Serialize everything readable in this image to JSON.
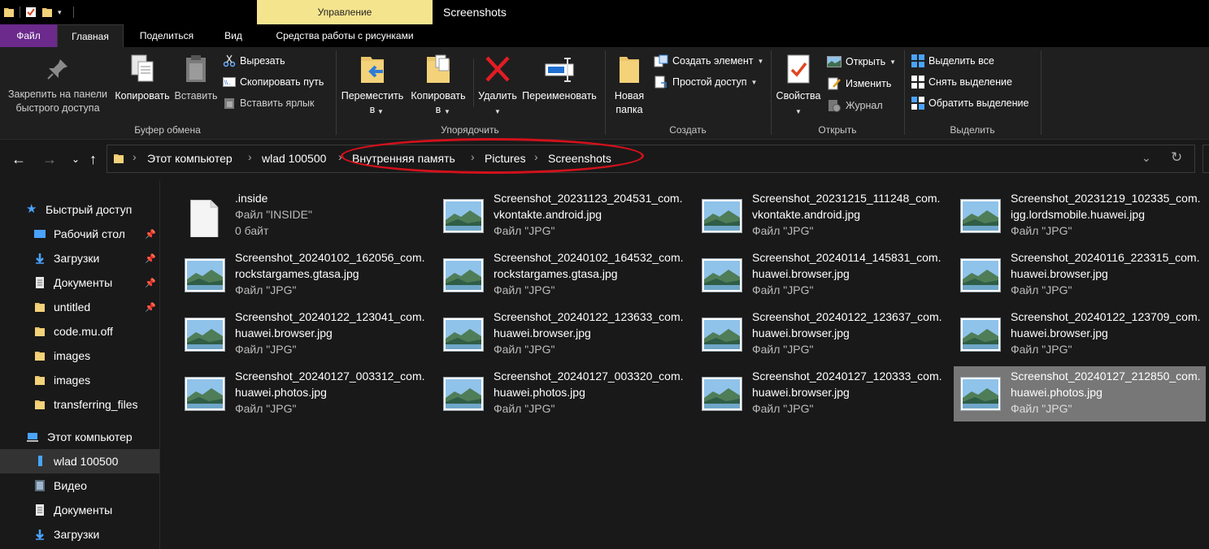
{
  "window": {
    "title": "Screenshots",
    "context_tab_header": "Управление"
  },
  "ribbon_tabs": {
    "file": "Файл",
    "home": "Главная",
    "share": "Поделиться",
    "view": "Вид",
    "picture_tools": "Средства работы с рисунками"
  },
  "ribbon": {
    "clipboard": {
      "label": "Буфер обмена",
      "pin_line1": "Закрепить на панели",
      "pin_line2": "быстрого доступа",
      "copy": "Копировать",
      "paste": "Вставить",
      "cut": "Вырезать",
      "copy_path": "Скопировать путь",
      "paste_shortcut": "Вставить ярлык"
    },
    "organize": {
      "label": "Упорядочить",
      "move_line1": "Переместить",
      "move_line2": "в",
      "copyto_line1": "Копировать",
      "copyto_line2": "в",
      "delete": "Удалить",
      "rename": "Переименовать"
    },
    "new": {
      "label": "Создать",
      "new_folder_line1": "Новая",
      "new_folder_line2": "папка",
      "new_item": "Создать элемент",
      "easy_access": "Простой доступ"
    },
    "open": {
      "label": "Открыть",
      "properties": "Свойства",
      "open": "Открыть",
      "edit": "Изменить",
      "history": "Журнал"
    },
    "select": {
      "label": "Выделить",
      "select_all": "Выделить все",
      "select_none": "Снять выделение",
      "invert": "Обратить выделение"
    }
  },
  "address": {
    "crumbs": [
      "Этот компьютер",
      "wlad 100500",
      "Внутренняя память",
      "Pictures",
      "Screenshots"
    ]
  },
  "nav_pane": {
    "quick_access": "Быстрый доступ",
    "items": [
      "Рабочий стол",
      "Загрузки",
      "Документы",
      "untitled",
      "code.mu.off",
      "images",
      "images",
      "transferring_files"
    ],
    "this_pc": "Этот компьютер",
    "pc_items": [
      "wlad 100500",
      "Видео",
      "Документы",
      "Загрузки"
    ]
  },
  "files": [
    {
      "name1": ".inside",
      "name2": "Файл \"INSIDE\"",
      "type": "0 байт"
    },
    {
      "name1": "Screenshot_20231123_204531_com.",
      "name2": "vkontakte.android.jpg",
      "type": "Файл \"JPG\""
    },
    {
      "name1": "Screenshot_20231215_111248_com.",
      "name2": "vkontakte.android.jpg",
      "type": "Файл \"JPG\""
    },
    {
      "name1": "Screenshot_20231219_102335_com.",
      "name2": "igg.lordsmobile.huawei.jpg",
      "type": "Файл \"JPG\""
    },
    {
      "name1": "Screenshot_20240102_162056_com.",
      "name2": "rockstargames.gtasa.jpg",
      "type": "Файл \"JPG\""
    },
    {
      "name1": "Screenshot_20240102_164532_com.",
      "name2": "rockstargames.gtasa.jpg",
      "type": "Файл \"JPG\""
    },
    {
      "name1": "Screenshot_20240114_145831_com.",
      "name2": "huawei.browser.jpg",
      "type": "Файл \"JPG\""
    },
    {
      "name1": "Screenshot_20240116_223315_com.",
      "name2": "huawei.browser.jpg",
      "type": "Файл \"JPG\""
    },
    {
      "name1": "Screenshot_20240122_123041_com.",
      "name2": "huawei.browser.jpg",
      "type": "Файл \"JPG\""
    },
    {
      "name1": "Screenshot_20240122_123633_com.",
      "name2": "huawei.browser.jpg",
      "type": "Файл \"JPG\""
    },
    {
      "name1": "Screenshot_20240122_123637_com.",
      "name2": "huawei.browser.jpg",
      "type": "Файл \"JPG\""
    },
    {
      "name1": "Screenshot_20240122_123709_com.",
      "name2": "huawei.browser.jpg",
      "type": "Файл \"JPG\""
    },
    {
      "name1": "Screenshot_20240127_003312_com.",
      "name2": "huawei.photos.jpg",
      "type": "Файл \"JPG\""
    },
    {
      "name1": "Screenshot_20240127_003320_com.",
      "name2": "huawei.photos.jpg",
      "type": "Файл \"JPG\""
    },
    {
      "name1": "Screenshot_20240127_120333_com.",
      "name2": "huawei.browser.jpg",
      "type": "Файл \"JPG\""
    },
    {
      "name1": "Screenshot_20240127_212850_com.",
      "name2": "huawei.photos.jpg",
      "type": "Файл \"JPG\""
    }
  ],
  "colors": {
    "file_tab": "#6b2a8c",
    "context_header": "#f5e48e",
    "annotation": "#d2111b",
    "selected": "#777777"
  }
}
